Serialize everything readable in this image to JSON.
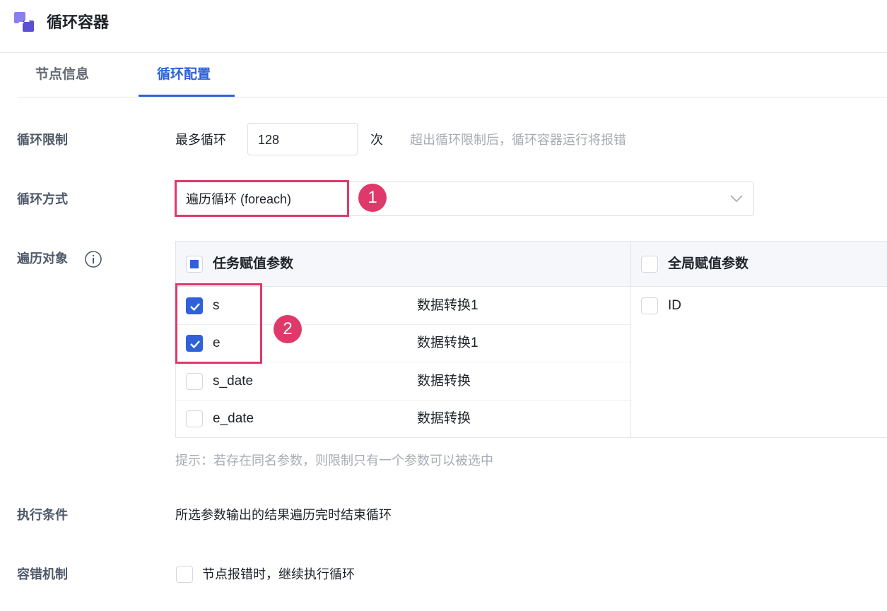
{
  "header": {
    "title": "循环容器",
    "logo_icon": "loop-container-icon"
  },
  "tabs": [
    {
      "label": "节点信息",
      "active": false
    },
    {
      "label": "循环配置",
      "active": true
    }
  ],
  "accent_color": "#2f62d8",
  "annotation_color": "#e0386a",
  "form": {
    "loop_limit": {
      "label": "循环限制",
      "prefix": "最多循环",
      "value": "128",
      "unit": "次",
      "hint": "超出循环限制后，循环容器运行将报错"
    },
    "loop_mode": {
      "label": "循环方式",
      "selected": "遍历循环 (foreach)",
      "icon": "chevron-down-icon"
    },
    "iterate_target": {
      "label": "遍历对象",
      "info_icon": "info-icon",
      "task_params": {
        "header": "任务赋值参数",
        "header_state": "indeterminate",
        "rows": [
          {
            "name": "s",
            "source": "数据转换1",
            "checked": true
          },
          {
            "name": "e",
            "source": "数据转换1",
            "checked": true
          },
          {
            "name": "s_date",
            "source": "数据转换",
            "checked": false
          },
          {
            "name": "e_date",
            "source": "数据转换",
            "checked": false
          }
        ]
      },
      "global_params": {
        "header": "全局赋值参数",
        "header_state": "unchecked",
        "rows": [
          {
            "name": "ID",
            "checked": false
          }
        ]
      },
      "tip": "提示：若存在同名参数，则限制只有一个参数可以被选中"
    },
    "exec_condition": {
      "label": "执行条件",
      "text": "所选参数输出的结果遍历完时结束循环"
    },
    "fault_tolerance": {
      "label": "容错机制",
      "option": "节点报错时，继续执行循环",
      "checked": false
    }
  },
  "annotations": [
    {
      "number": "1"
    },
    {
      "number": "2"
    }
  ]
}
